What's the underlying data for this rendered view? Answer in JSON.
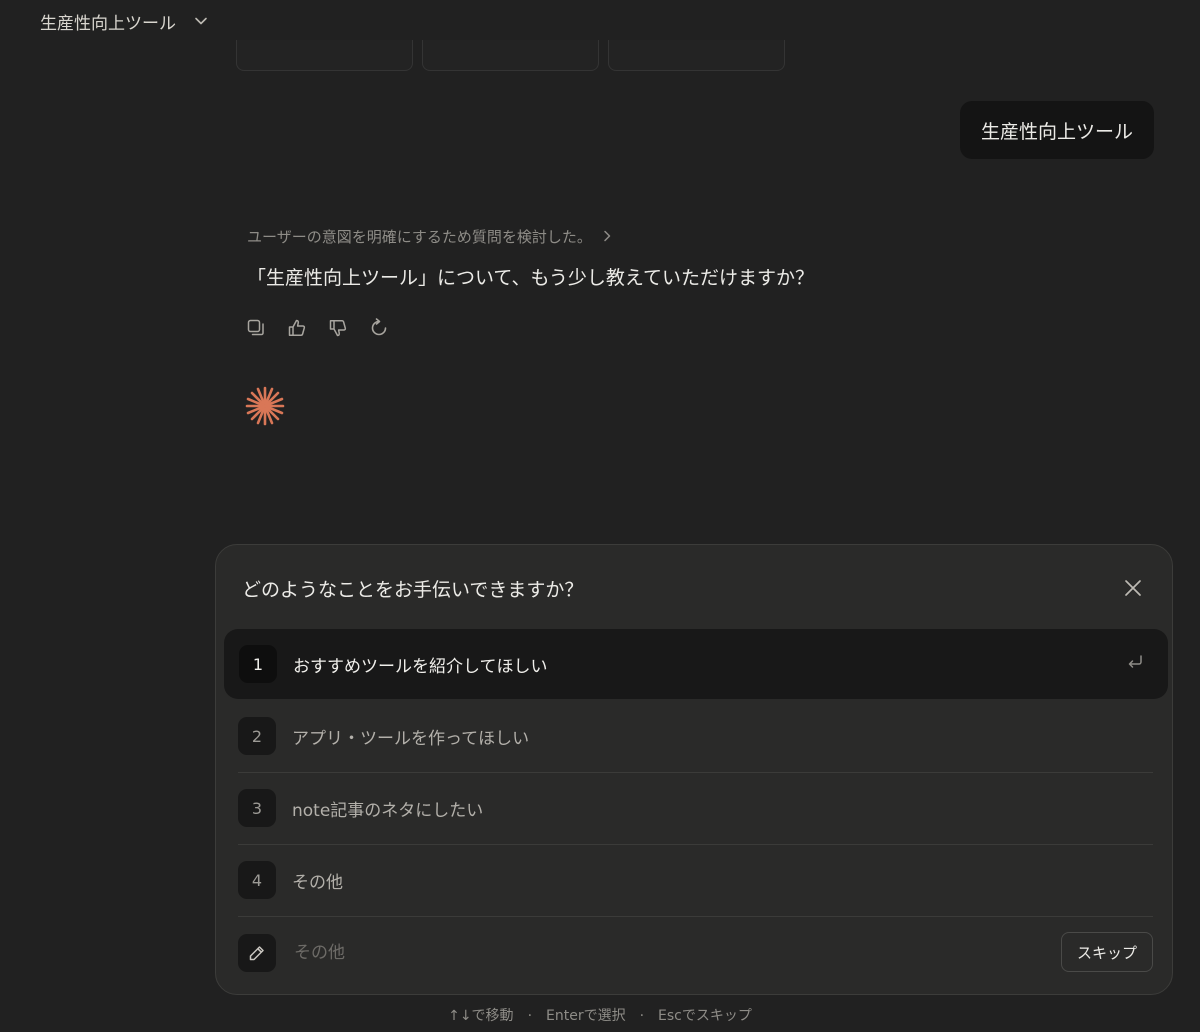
{
  "header": {
    "title": "生産性向上ツール"
  },
  "conversation": {
    "user_message": "生産性向上ツール",
    "thinking_summary": "ユーザーの意図を明確にするため質問を検討した。",
    "assistant_message": "「生産性向上ツール」について、もう少し教えていただけますか？"
  },
  "icons": {
    "copy": "copy-icon",
    "thumbs_up": "thumbs-up-icon",
    "thumbs_down": "thumbs-down-icon",
    "retry": "retry-icon",
    "close": "close-icon",
    "enter": "enter-icon",
    "pencil": "pencil-icon",
    "spark": "spark-icon"
  },
  "colors": {
    "accent": "#d97757",
    "background": "#212121",
    "panel": "#2a2a29"
  },
  "question_panel": {
    "question": "どのようなことをお手伝いできますか？",
    "options": [
      {
        "number": "1",
        "label": "おすすめツールを紹介してほしい",
        "selected": true
      },
      {
        "number": "2",
        "label": "アプリ・ツールを作ってほしい",
        "selected": false
      },
      {
        "number": "3",
        "label": "note記事のネタにしたい",
        "selected": false
      },
      {
        "number": "4",
        "label": "その他",
        "selected": false
      }
    ],
    "custom_placeholder": "その他",
    "skip_label": "スキップ"
  },
  "hints": {
    "move": "↑↓で移動",
    "select": "Enterで選択",
    "skip": "Escでスキップ",
    "separator": "·"
  }
}
